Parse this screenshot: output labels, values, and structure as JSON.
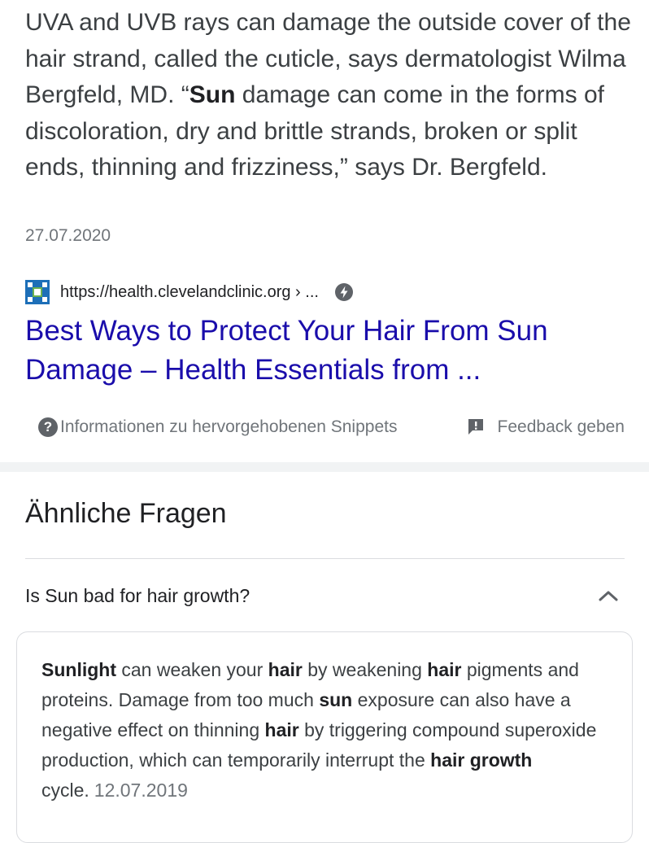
{
  "snippet": {
    "p1": "UVA and UVB rays can damage the outside cover of the hair strand, called the cuticle, says dermatologist Wilma Bergfeld, MD. “",
    "b1": "Sun",
    "p2": " damage can come in the forms of discoloration, dry and brittle strands, broken or split ends, thinning and frizziness,” says Dr. Bergfeld.",
    "date": "27.07.2020"
  },
  "source": {
    "favicon_icon": "cleveland-clinic-logo",
    "url": "https://health.clevelandclinic.org › ...",
    "amp_icon": "amp-lightning-icon",
    "title": "Best Ways to Protect Your Hair From Sun Damage – Health Essentials from ..."
  },
  "footer": {
    "info_label": "Informationen zu hervorgehobenen Snippets",
    "feedback_label": "Feedback geben"
  },
  "related": {
    "heading": "Ähnliche Fragen",
    "question": "Is Sun bad for hair growth?",
    "answer": {
      "s1b": "Sunlight",
      "s2": " can weaken your ",
      "s3b": "hair",
      "s4": " by weakening ",
      "s5b": "hair",
      "s6": " pigments and proteins. Damage from too much ",
      "s7b": "sun",
      "s8": " exposure can also have a negative effect on thinning ",
      "s9b": "hair",
      "s10": " by triggering compound superoxide production, which can temporarily interrupt the ",
      "s11b": "hair growth",
      "s12": " cycle.",
      "date": "12.07.2019"
    }
  },
  "colors": {
    "link": "#1a0dab",
    "text": "#202124",
    "muted": "#70757a",
    "favicon_blue": "#1d6fb8",
    "favicon_green": "#69b04f"
  }
}
